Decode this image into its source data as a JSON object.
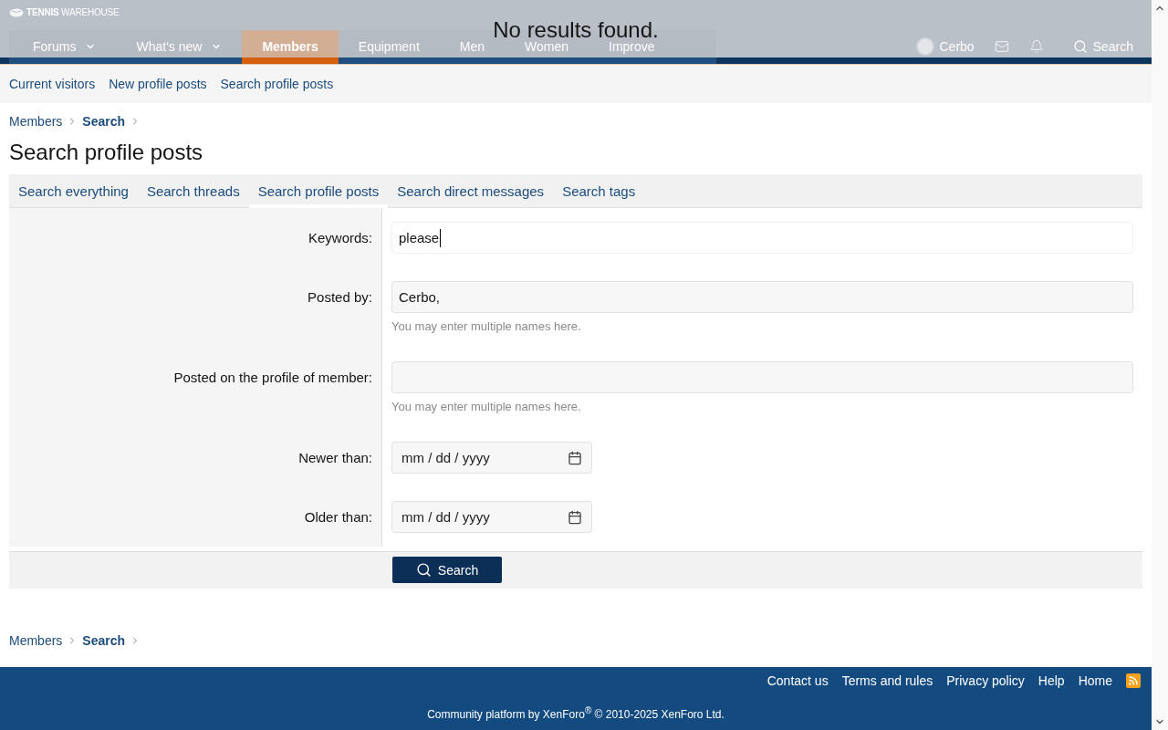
{
  "notice": {
    "text": "No results found."
  },
  "header": {
    "logo": "**TENNIS** WAREHOUSE",
    "nav": [
      {
        "label": "Forums",
        "has_menu": true,
        "selected": false
      },
      {
        "label": "What's new",
        "has_menu": true,
        "selected": false
      },
      {
        "label": "Members",
        "has_menu": false,
        "selected": true
      },
      {
        "label": "Equipment",
        "has_menu": false,
        "selected": false
      },
      {
        "label": "Men",
        "has_menu": false,
        "selected": false
      },
      {
        "label": "Women",
        "has_menu": false,
        "selected": false
      },
      {
        "label": "Improve",
        "has_menu": false,
        "selected": false
      }
    ],
    "user": {
      "name": "Cerbo"
    },
    "search": {
      "label": "Search"
    }
  },
  "subnav": [
    {
      "label": "Current visitors"
    },
    {
      "label": "New profile posts"
    },
    {
      "label": "Search profile posts"
    }
  ],
  "breadcrumb": [
    {
      "label": "Members",
      "current": false
    },
    {
      "label": "Search",
      "current": true
    }
  ],
  "page_title": "Search profile posts",
  "search_tabs": [
    {
      "label": "Search everything",
      "selected": false
    },
    {
      "label": "Search threads",
      "selected": false
    },
    {
      "label": "Search profile posts",
      "selected": true
    },
    {
      "label": "Search direct messages",
      "selected": false
    },
    {
      "label": "Search tags",
      "selected": false
    }
  ],
  "form": {
    "fields": [
      {
        "kind": "text",
        "label": "Keywords:",
        "value": "please",
        "focused": true
      },
      {
        "kind": "text",
        "label": "Posted by:",
        "value": "Cerbo,",
        "focused": false,
        "hint": "You may enter multiple names here."
      },
      {
        "kind": "text",
        "label": "Posted on the profile of member:",
        "focused": false,
        "hint": "You may enter multiple names here."
      },
      {
        "kind": "date",
        "label": "Newer than:",
        "placeholder": "mm / dd / yyyy",
        "focused": false
      },
      {
        "kind": "date",
        "label": "Older than:",
        "placeholder": "mm / dd / yyyy",
        "focused": false
      }
    ],
    "submit": {
      "label": "Search"
    }
  },
  "breadcrumb_bottom": [
    {
      "label": "Members",
      "current": false
    },
    {
      "label": "Search",
      "current": true
    }
  ],
  "footer": {
    "links": [
      "Contact us",
      "Terms and rules",
      "Privacy policy",
      "Help",
      "Home"
    ],
    "copyright": "Community platform by XenForo$^{®}$ © 2010-2025 XenForo Ltd."
  }
}
